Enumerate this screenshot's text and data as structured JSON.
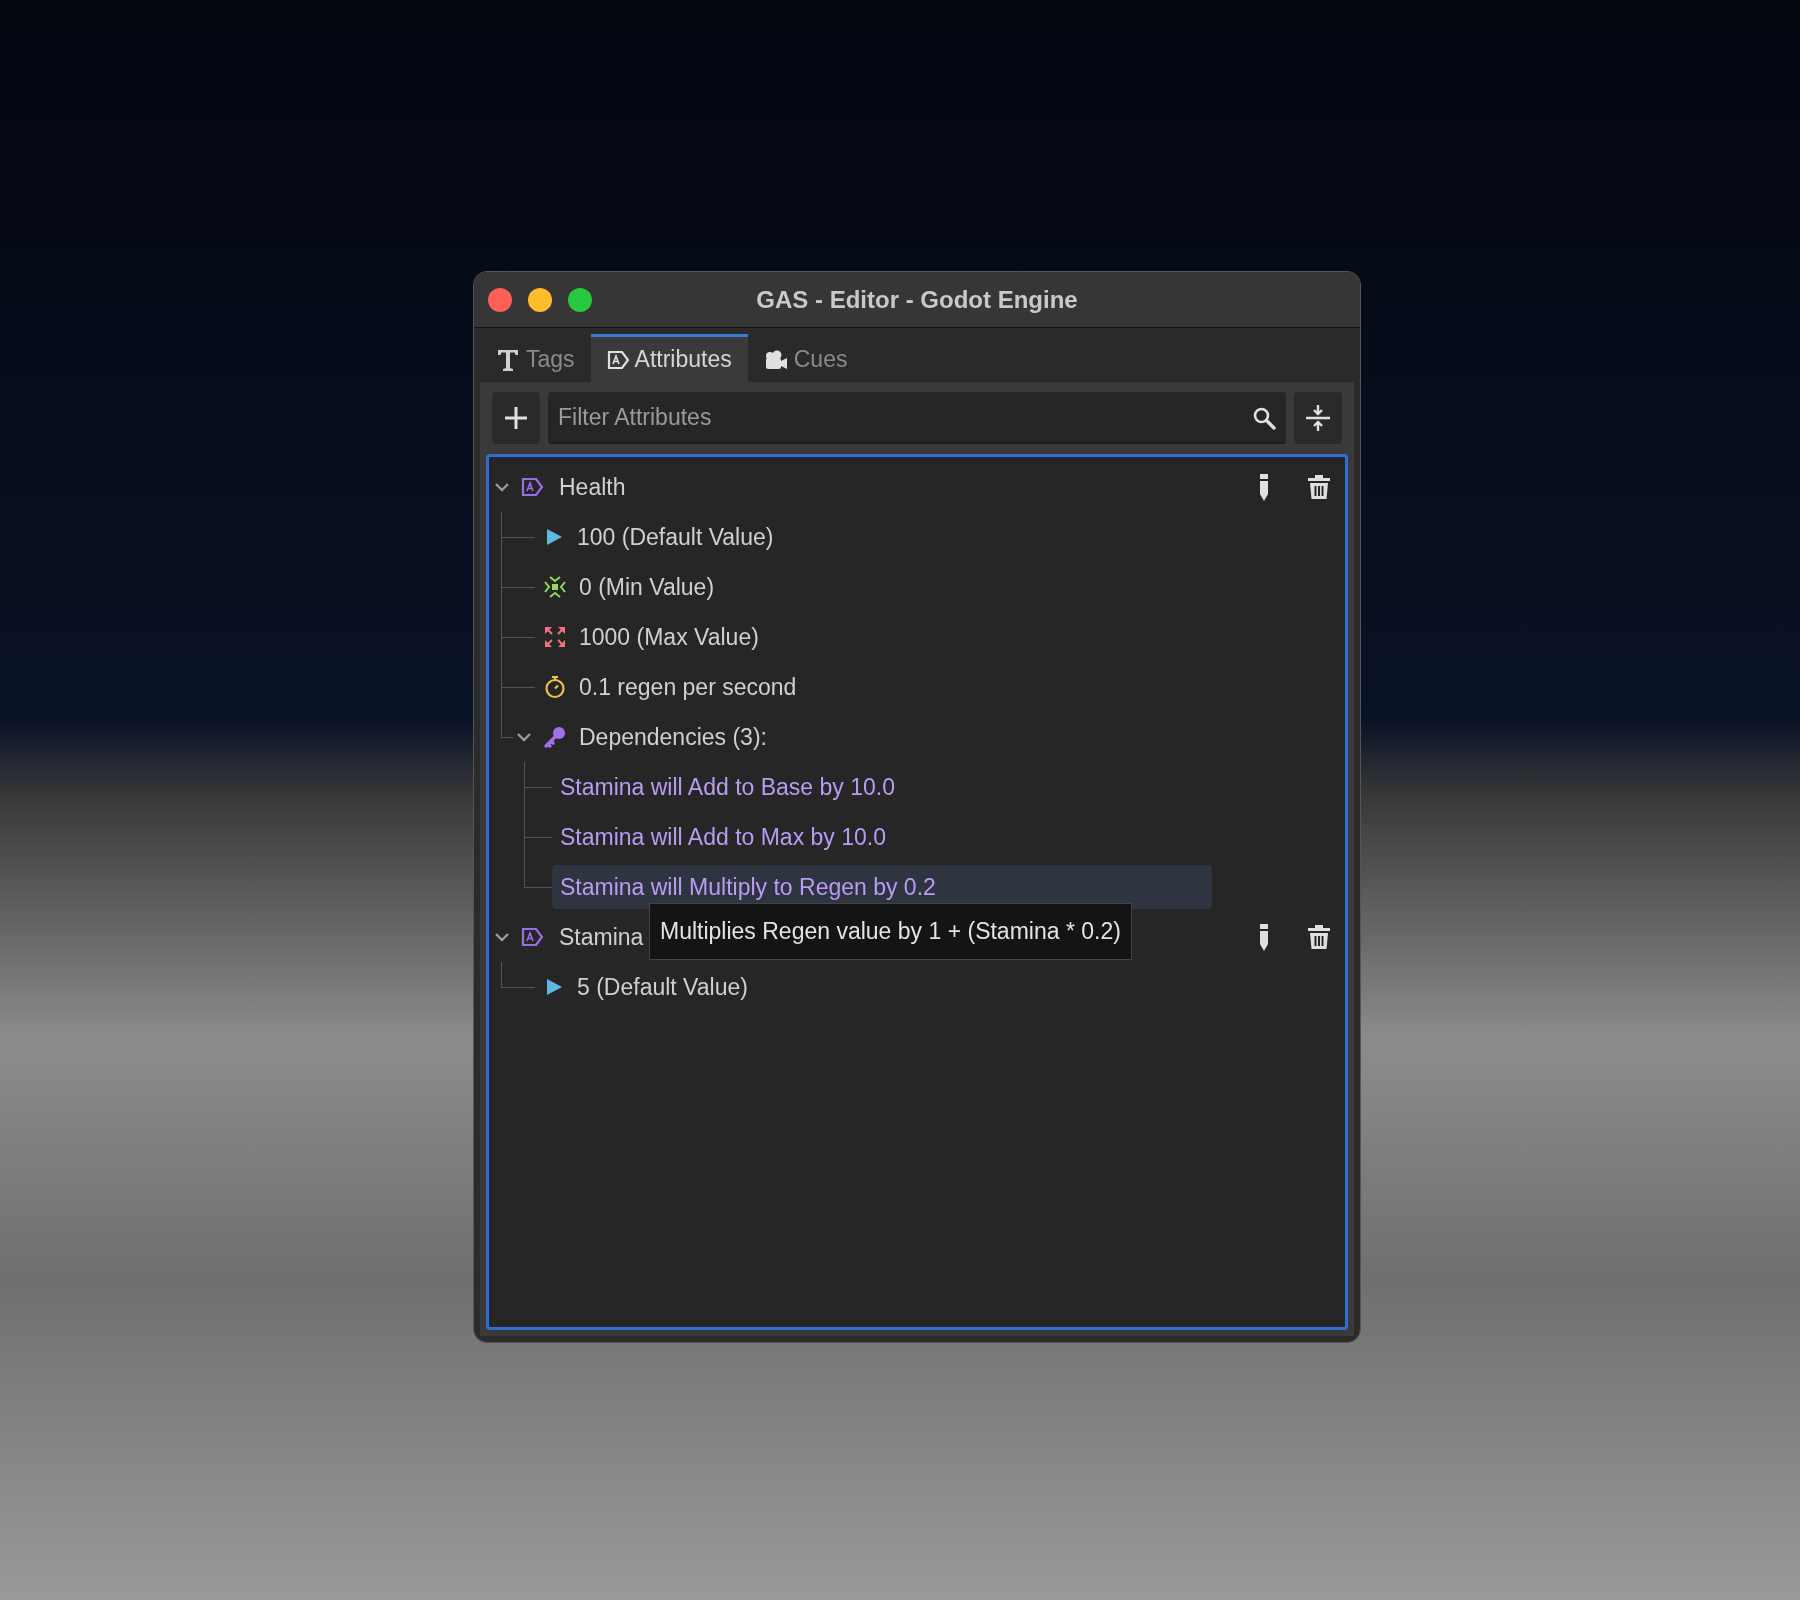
{
  "window": {
    "title": "GAS - Editor - Godot Engine"
  },
  "tabs": [
    {
      "kind": "tags",
      "label": "Tags",
      "selected": false
    },
    {
      "kind": "attributes",
      "label": "Attributes",
      "selected": true
    },
    {
      "kind": "cues",
      "label": "Cues",
      "selected": false
    }
  ],
  "search": {
    "placeholder": "Filter Attributes"
  },
  "tree": [
    {
      "kind": "attribute",
      "label": "Health",
      "expanded": true,
      "selected": false,
      "children": [
        {
          "kind": "default",
          "label": "100 (Default Value)",
          "selected": false
        },
        {
          "kind": "min",
          "label": "0 (Min Value)",
          "selected": false
        },
        {
          "kind": "max",
          "label": "1000 (Max Value)",
          "selected": false
        },
        {
          "kind": "regen",
          "label": "0.1 regen per second",
          "selected": false
        },
        {
          "kind": "dependencies",
          "label": "Dependencies (3):",
          "expanded": true,
          "selected": false,
          "children": [
            {
              "kind": "dependency",
              "label": "Stamina will Add to Base by 10.0",
              "selected": false
            },
            {
              "kind": "dependency",
              "label": "Stamina will Add to Max by 10.0",
              "selected": false
            },
            {
              "kind": "dependency",
              "label": "Stamina will Multiply to Regen by 0.2",
              "selected": true
            }
          ]
        }
      ]
    },
    {
      "kind": "attribute",
      "label": "Stamina",
      "expanded": true,
      "selected": false,
      "children": [
        {
          "kind": "default",
          "label": "5 (Default Value)",
          "selected": false
        }
      ]
    }
  ],
  "tooltip": {
    "text": "Multiplies Regen value by 1 + (Stamina * 0.2)"
  }
}
